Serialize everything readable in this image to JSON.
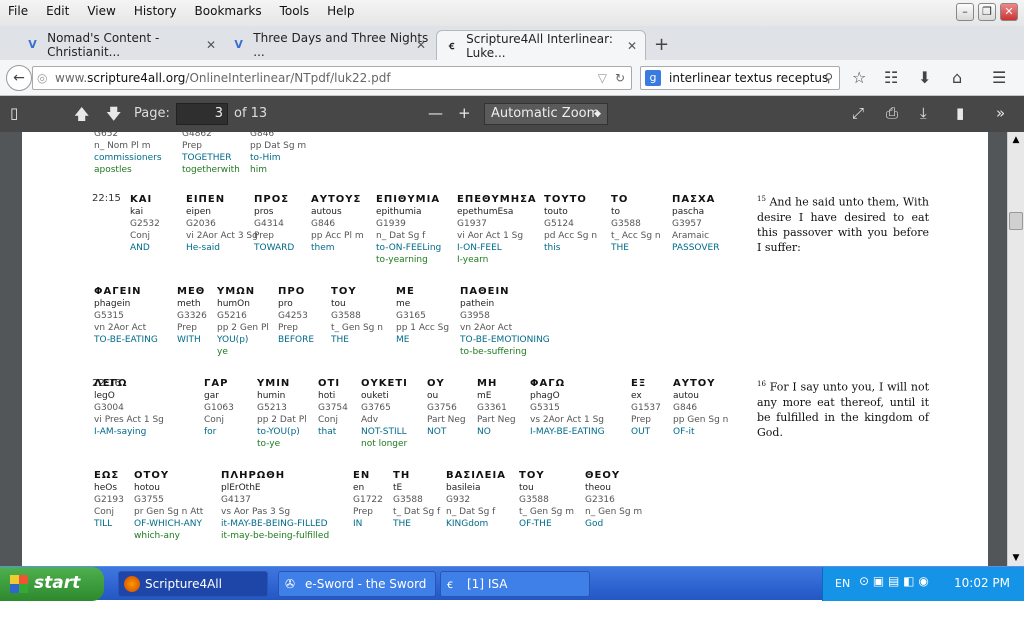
{
  "menu": [
    "File",
    "Edit",
    "View",
    "History",
    "Bookmarks",
    "Tools",
    "Help"
  ],
  "tabs": [
    {
      "label": "Nomad's Content - Christianit..."
    },
    {
      "label": "Three Days and Three Nights ..."
    },
    {
      "label": "Scripture4All Interlinear: Luke..."
    }
  ],
  "url": {
    "prefix": "www.",
    "host": "scripture4all.org",
    "path": "/OnlineInterlinear/NTpdf/luk22.pdf"
  },
  "search": {
    "value": "interlinear textus receptus"
  },
  "pdf": {
    "page_label": "Page:",
    "page": "3",
    "of": "of 13",
    "zoom": "Automatic Zoom"
  },
  "top_words": [
    {
      "s": "G652",
      "p": "n_ Nom Pl m",
      "e1": "commissioners",
      "e2": "apostles"
    },
    {
      "s": "G4862",
      "p": "Prep",
      "e1": "TOGETHER",
      "e2": "togetherwith"
    },
    {
      "s": "G846",
      "p": "pp Dat Sg m",
      "e1": "to-Him",
      "e2": "him"
    }
  ],
  "verses": [
    {
      "ref": "22:15",
      "lines": [
        [
          {
            "g": "ΚΑΙ",
            "t": "kai",
            "s": "G2532",
            "p": "Conj",
            "e1": "AND",
            "e2": ""
          },
          {
            "g": "ΕΙΠΕΝ",
            "t": "eipen",
            "s": "G2036",
            "p": "vi 2Aor Act 3 Sg",
            "e1": "He-said",
            "e2": ""
          },
          {
            "g": "ΠΡΟΣ",
            "t": "pros",
            "s": "G4314",
            "p": "Prep",
            "e1": "TOWARD",
            "e2": ""
          },
          {
            "g": "ΑΥΤΟΥΣ",
            "t": "autous",
            "s": "G846",
            "p": "pp Acc Pl m",
            "e1": "them",
            "e2": ""
          },
          {
            "g": "ΕΠΙΘΥΜΙΑ",
            "t": "epithumia",
            "s": "G1939",
            "p": "n_ Dat Sg f",
            "e1": "to-ON-FEELing",
            "e2": "to-yearning"
          },
          {
            "g": "ΕΠΕΘΥΜΗΣΑ",
            "t": "epethumEsa",
            "s": "G1937",
            "p": "vi Aor Act 1 Sg",
            "e1": "I-ON-FEEL",
            "e2": "I-yearn"
          },
          {
            "g": "ΤΟΥΤΟ",
            "t": "touto",
            "s": "G5124",
            "p": "pd Acc Sg n",
            "e1": "this",
            "e2": ""
          },
          {
            "g": "ΤΟ",
            "t": "to",
            "s": "G3588",
            "p": "t_ Acc Sg n",
            "e1": "THE",
            "e2": ""
          },
          {
            "g": "ΠΑΣΧΑ",
            "t": "pascha",
            "s": "G3957",
            "p": "Aramaic",
            "e1": "PASSOVER",
            "e2": ""
          }
        ],
        [
          {
            "g": "ΦΑΓΕΙΝ",
            "t": "phagein",
            "s": "G5315",
            "p": "vn 2Aor Act",
            "e1": "TO-BE-EATING",
            "e2": ""
          },
          {
            "g": "ΜΕΘ",
            "t": "meth",
            "s": "G3326",
            "p": "Prep",
            "e1": "WITH",
            "e2": ""
          },
          {
            "g": "ΥΜΩΝ",
            "t": "humOn",
            "s": "G5216",
            "p": "pp 2 Gen Pl",
            "e1": "YOU(p)",
            "e2": "ye"
          },
          {
            "g": "ΠΡΟ",
            "t": "pro",
            "s": "G4253",
            "p": "Prep",
            "e1": "BEFORE",
            "e2": ""
          },
          {
            "g": "ΤΟΥ",
            "t": "tou",
            "s": "G3588",
            "p": "t_ Gen Sg n",
            "e1": "THE",
            "e2": ""
          },
          {
            "g": "ΜΕ",
            "t": "me",
            "s": "G3165",
            "p": "pp 1 Acc Sg",
            "e1": "ME",
            "e2": ""
          },
          {
            "g": "ΠΑΘΕΙΝ",
            "t": "pathein",
            "s": "G3958",
            "p": "vn 2Aor Act",
            "e1": "TO-BE-EMOTIONING",
            "e2": "to-be-suffering"
          }
        ]
      ],
      "num": "15",
      "english": "And he said unto them, With desire I have desired to eat this passover with you before I suffer:"
    },
    {
      "ref": "22:16",
      "lines": [
        [
          {
            "g": "ΛΕΓΩ",
            "t": "legO",
            "s": "G3004",
            "p": "vi Pres Act 1 Sg",
            "e1": "I-AM-saying",
            "e2": ""
          },
          {
            "g": "ΓΑΡ",
            "t": "gar",
            "s": "G1063",
            "p": "Conj",
            "e1": "for",
            "e2": ""
          },
          {
            "g": "ΥΜΙΝ",
            "t": "humin",
            "s": "G5213",
            "p": "pp 2 Dat Pl",
            "e1": "to-YOU(p)",
            "e2": "to-ye"
          },
          {
            "g": "ΟΤΙ",
            "t": "hoti",
            "s": "G3754",
            "p": "Conj",
            "e1": "that",
            "e2": ""
          },
          {
            "g": "ΟΥΚΕΤΙ",
            "t": "ouketi",
            "s": "G3765",
            "p": "Adv",
            "e1": "NOT-STILL",
            "e2": "not longer"
          },
          {
            "g": "ΟΥ",
            "t": "ou",
            "s": "G3756",
            "p": "Part Neg",
            "e1": "NOT",
            "e2": ""
          },
          {
            "g": "ΜΗ",
            "t": "mE",
            "s": "G3361",
            "p": "Part Neg",
            "e1": "NO",
            "e2": ""
          },
          {
            "g": "ΦΑΓΩ",
            "t": "phagO",
            "s": "G5315",
            "p": "vs 2Aor Act 1 Sg",
            "e1": "I-MAY-BE-EATING",
            "e2": ""
          },
          {
            "g": "ΕΞ",
            "t": "ex",
            "s": "G1537",
            "p": "Prep",
            "e1": "OUT",
            "e2": ""
          },
          {
            "g": "ΑΥΤΟΥ",
            "t": "autou",
            "s": "G846",
            "p": "pp Gen Sg n",
            "e1": "OF-it",
            "e2": ""
          }
        ],
        [
          {
            "g": "ΕΩΣ",
            "t": "heOs",
            "s": "G2193",
            "p": "Conj",
            "e1": "TILL",
            "e2": ""
          },
          {
            "g": "ΟΤΟΥ",
            "t": "hotou",
            "s": "G3755",
            "p": "pr Gen Sg n Att",
            "e1": "OF-WHICH-ANY",
            "e2": "which-any"
          },
          {
            "g": "ΠΛΗΡΩΘΗ",
            "t": "plErOthE",
            "s": "G4137",
            "p": "vs Aor Pas 3 Sg",
            "e1": "it-MAY-BE-BEING-FILLED",
            "e2": "it-may-be-being-fulfilled"
          },
          {
            "g": "ΕΝ",
            "t": "en",
            "s": "G1722",
            "p": "Prep",
            "e1": "IN",
            "e2": ""
          },
          {
            "g": "ΤΗ",
            "t": "tE",
            "s": "G3588",
            "p": "t_ Dat Sg f",
            "e1": "THE",
            "e2": ""
          },
          {
            "g": "ΒΑΣΙΛΕΙΑ",
            "t": "basileia",
            "s": "G932",
            "p": "n_ Dat Sg f",
            "e1": "KINGdom",
            "e2": ""
          },
          {
            "g": "ΤΟΥ",
            "t": "tou",
            "s": "G3588",
            "p": "t_ Gen Sg m",
            "e1": "OF-THE",
            "e2": ""
          },
          {
            "g": "ΘΕΟΥ",
            "t": "theou",
            "s": "G2316",
            "p": "n_ Gen Sg m",
            "e1": "God",
            "e2": ""
          }
        ]
      ],
      "num": "16",
      "english": "For I say unto you, I will not any more eat thereof, until it be fulfilled in the kingdom of God."
    }
  ],
  "taskbar": {
    "start": "start",
    "items": [
      "Scripture4All Interline...",
      "e-Sword - the Sword ...",
      "[1] ISA"
    ],
    "lang": "EN",
    "clock": "10:02 PM"
  }
}
